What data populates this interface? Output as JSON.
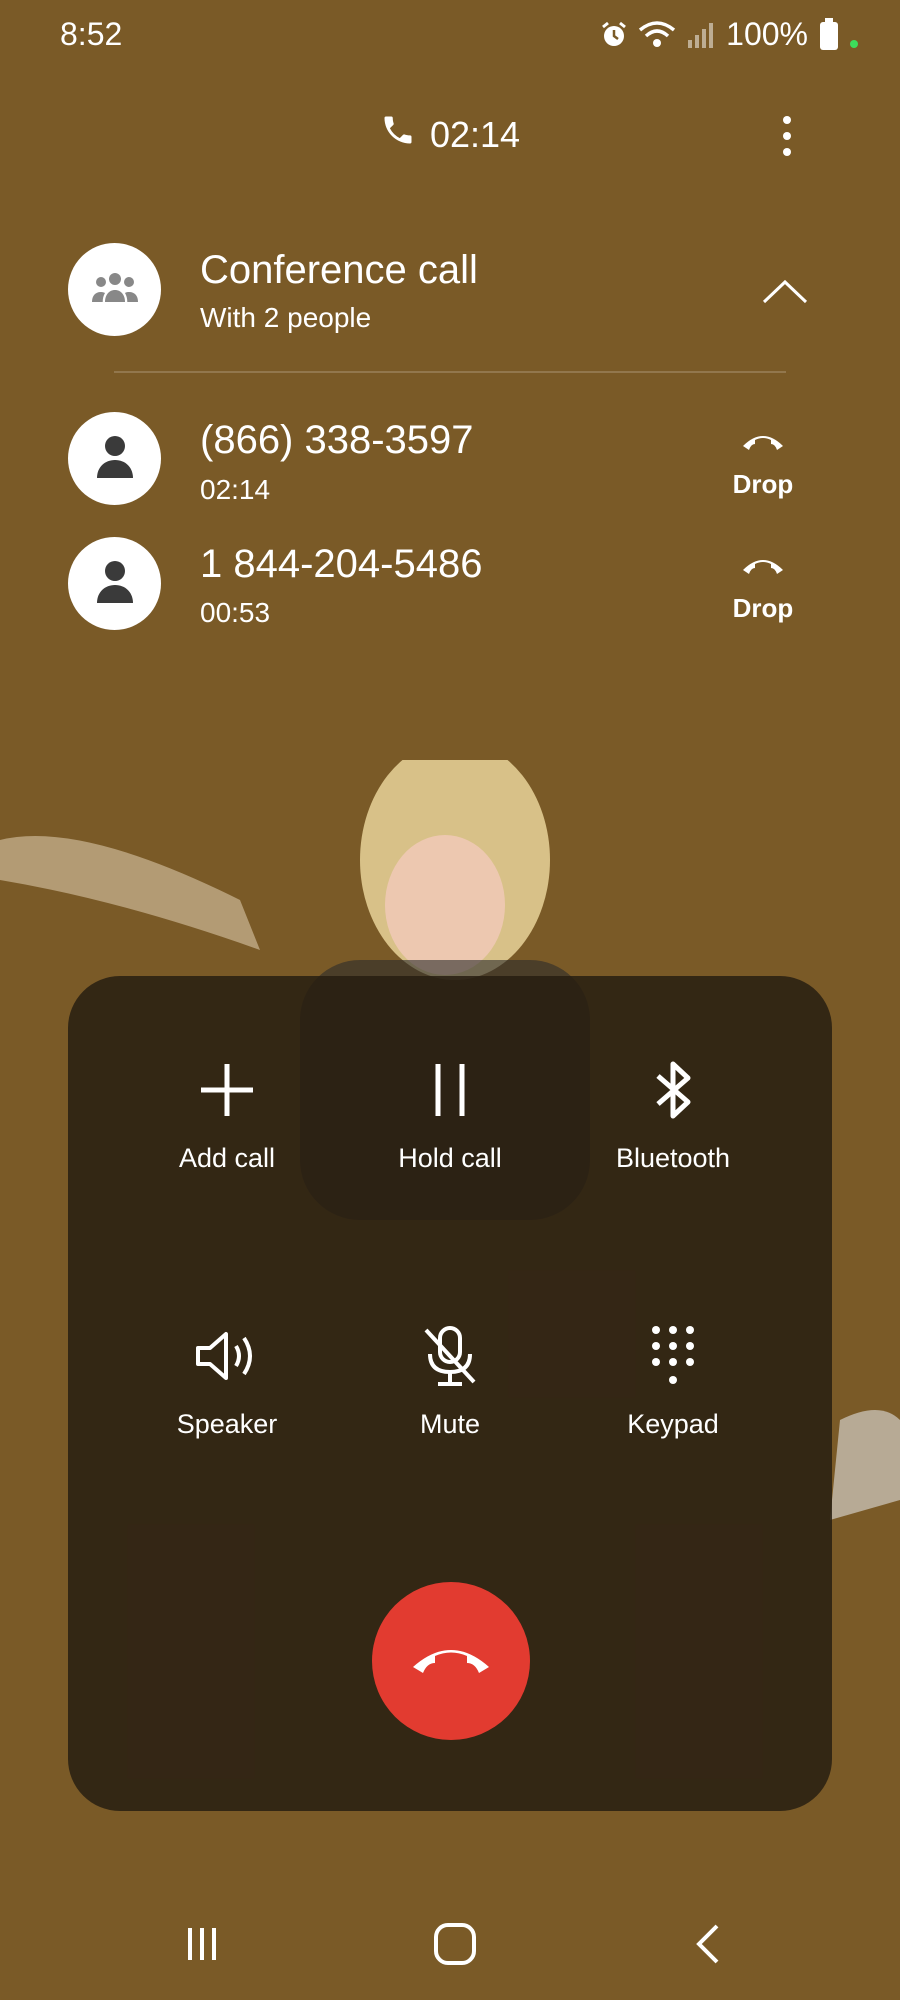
{
  "status_bar": {
    "time": "8:52",
    "battery_percent": "100%",
    "icons": [
      "alarm-icon",
      "wifi-icon",
      "signal-icon",
      "battery-icon"
    ]
  },
  "call": {
    "elapsed": "02:14"
  },
  "conference": {
    "title": "Conference call",
    "subtitle": "With 2 people"
  },
  "participants": [
    {
      "number": "(866) 338-3597",
      "duration": "02:14",
      "drop_label": "Drop"
    },
    {
      "number": "1 844-204-5486",
      "duration": "00:53",
      "drop_label": "Drop"
    }
  ],
  "controls": {
    "add_call": "Add call",
    "hold_call": "Hold call",
    "bluetooth": "Bluetooth",
    "speaker": "Speaker",
    "mute": "Mute",
    "keypad": "Keypad"
  },
  "colors": {
    "background": "#7a5a27",
    "end_call": "#e23b30",
    "panel": "#281e12"
  }
}
